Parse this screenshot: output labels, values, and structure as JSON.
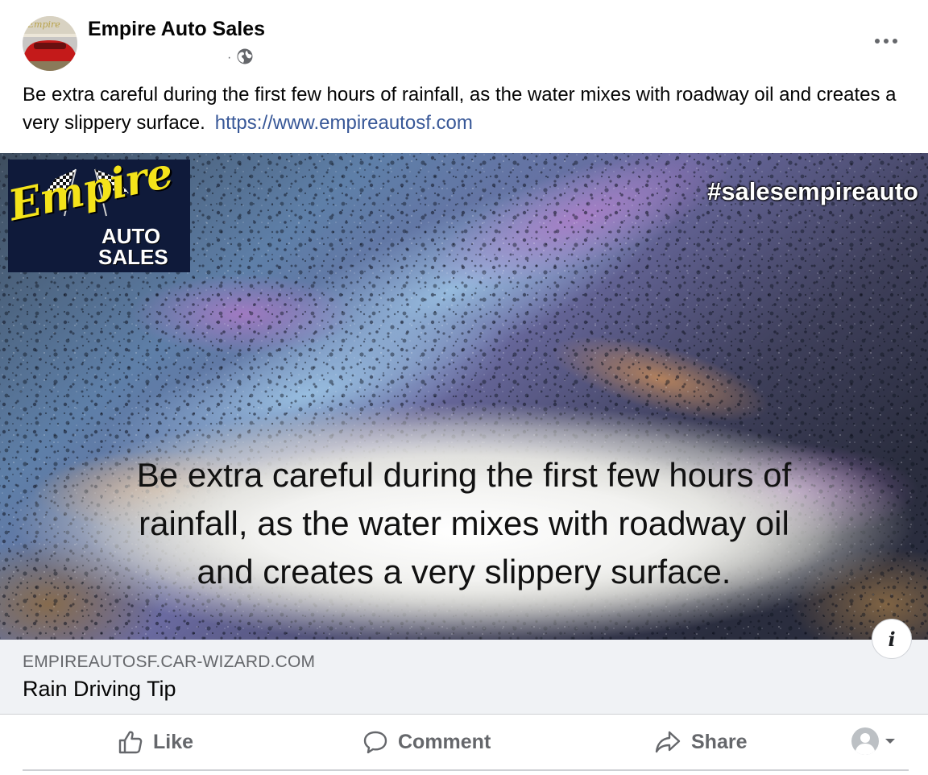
{
  "post": {
    "page_name": "Empire Auto Sales",
    "message": "Be extra careful during the first few hours of rainfall, as the water mixes with roadway oil and creates a very slippery surface.",
    "link_text": "https://www.empireautosf.com",
    "visibility_icon": "globe-icon"
  },
  "image": {
    "logo": {
      "script": "Empire",
      "line1": "AUTO",
      "line2": "SALES"
    },
    "hashtag": "#salesempireauto",
    "caption_lines": [
      "Be extra careful during the first few hours of",
      "rainfall, as the water mixes with roadway oil",
      "and creates a very slippery surface."
    ],
    "info_icon": "i"
  },
  "link_preview": {
    "domain": "EMPIREAUTOSF.CAR-WIZARD.COM",
    "title": "Rain Driving Tip"
  },
  "actions": {
    "like": "Like",
    "comment": "Comment",
    "share": "Share"
  },
  "colors": {
    "link": "#385898",
    "secondary_text": "#65676b",
    "preview_bg": "#f0f2f5",
    "logo_yellow": "#f4e31a"
  }
}
